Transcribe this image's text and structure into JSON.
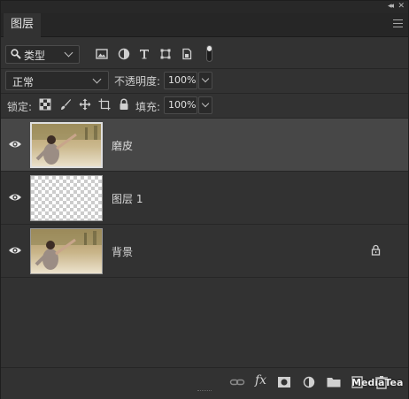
{
  "panel": {
    "tab_label": "图层",
    "collapse_glyph": "◂◂",
    "close_glyph": "✕"
  },
  "filter": {
    "kind_label": "类型",
    "icons": [
      "image-filter-icon",
      "adjustment-filter-icon",
      "type-filter-icon",
      "shape-filter-icon",
      "smart-object-filter-icon"
    ]
  },
  "blend": {
    "mode": "正常",
    "opacity_label": "不透明度:",
    "opacity_value": "100%"
  },
  "lock": {
    "label": "锁定:",
    "fill_label": "填充:",
    "fill_value": "100%",
    "icons": [
      "lock-transparent-icon",
      "lock-image-icon",
      "lock-position-icon",
      "lock-artboard-icon",
      "lock-all-icon"
    ]
  },
  "layers": [
    {
      "name": "磨皮",
      "selected": true,
      "thumb": "photo",
      "locked": false
    },
    {
      "name": "图层 1",
      "selected": false,
      "thumb": "transparent",
      "locked": false
    },
    {
      "name": "背景",
      "selected": false,
      "thumb": "photo",
      "locked": true
    }
  ],
  "bottom": {
    "icons": [
      "link-layers-icon",
      "fx-icon",
      "add-mask-icon",
      "adjustment-layer-icon",
      "group-folder-icon",
      "new-layer-icon",
      "delete-layer-icon"
    ],
    "fx_label": "fx",
    "watermark": "MediaTea"
  },
  "colors": {
    "panel_bg": "#323232",
    "selected_row": "#474747",
    "tab_bg": "#262626"
  }
}
